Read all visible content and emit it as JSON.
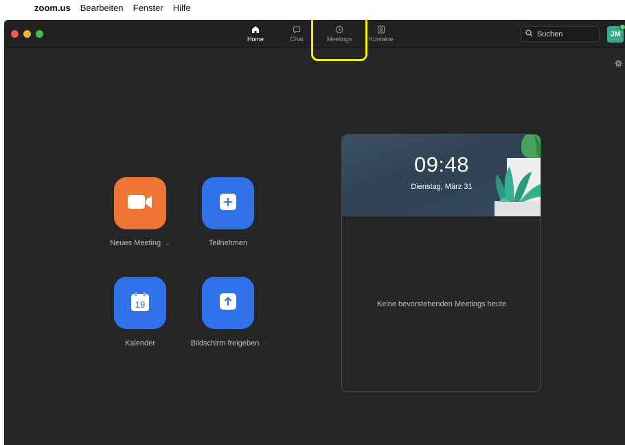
{
  "menubar": {
    "apple_glyph": "",
    "items": [
      "zoom.us",
      "Bearbeiten",
      "Fenster",
      "Hilfe"
    ]
  },
  "nav": {
    "tabs": [
      {
        "label": "Home",
        "icon": "home-icon",
        "active": true
      },
      {
        "label": "Chat",
        "icon": "chat-icon",
        "active": false
      },
      {
        "label": "Meetings",
        "icon": "clock-icon",
        "active": false
      },
      {
        "label": "Kontakte",
        "icon": "contact-icon",
        "active": false
      }
    ]
  },
  "search": {
    "placeholder": "Suchen"
  },
  "avatar": {
    "initials": "JM"
  },
  "actions": {
    "new_meeting": "Neues Meeting",
    "join": "Teilnehmen",
    "calendar": "Kalender",
    "calendar_day": "19",
    "share_screen": "Bildschirm freigeben"
  },
  "panel": {
    "time": "09:48",
    "date": "Dienstag, März 31",
    "empty_text": "Keine bevorstehenden Meetings heute"
  },
  "colors": {
    "orange": "#f07535",
    "blue": "#2f72ea",
    "highlight": "#f5f000",
    "avatar": "#3aaa8c"
  }
}
